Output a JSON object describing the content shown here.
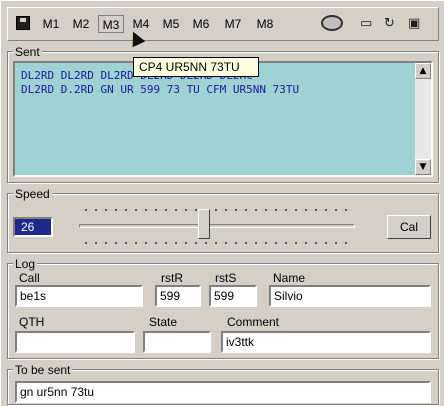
{
  "toolbar": {
    "save_icon": "floppy-disk-icon",
    "memory_buttons": [
      "M1",
      "M2",
      "M3",
      "M4",
      "M5",
      "M6",
      "M7",
      "M8"
    ],
    "record_icon": "circle-icon",
    "extra_icons": [
      "monitor-icon",
      "refresh-icon",
      "window-icon"
    ]
  },
  "tooltip": {
    "text": "CP4 UR5NN 73TU"
  },
  "sent": {
    "label": "Sent",
    "lines": [
      "DL2RD DL2RD DL2RD DL2RD DL2RD DL2RC",
      "DL2RD D.2RD GN UR 599 73 TU CFM UR5NN 73TU"
    ]
  },
  "speed": {
    "label": "Speed",
    "value": "26",
    "cal_label": "Cal"
  },
  "log": {
    "label": "Log",
    "call": {
      "label": "Call",
      "value": "be1s"
    },
    "rst_r": {
      "label": "rstR",
      "value": "599"
    },
    "rst_s": {
      "label": "rstS",
      "value": "599"
    },
    "name": {
      "label": "Name",
      "value": "Silvio"
    },
    "qth": {
      "label": "QTH",
      "value": ""
    },
    "state": {
      "label": "State",
      "value": ""
    },
    "comment": {
      "label": "Comment",
      "value": "iv3ttk"
    }
  },
  "to_be_sent": {
    "label": "To be sent",
    "value": "gn ur5nn 73tu"
  },
  "colors": {
    "sent_bg": "#9fd2d3",
    "sent_text": "#1a1aa0",
    "speed_bg": "#1e2a8a"
  }
}
